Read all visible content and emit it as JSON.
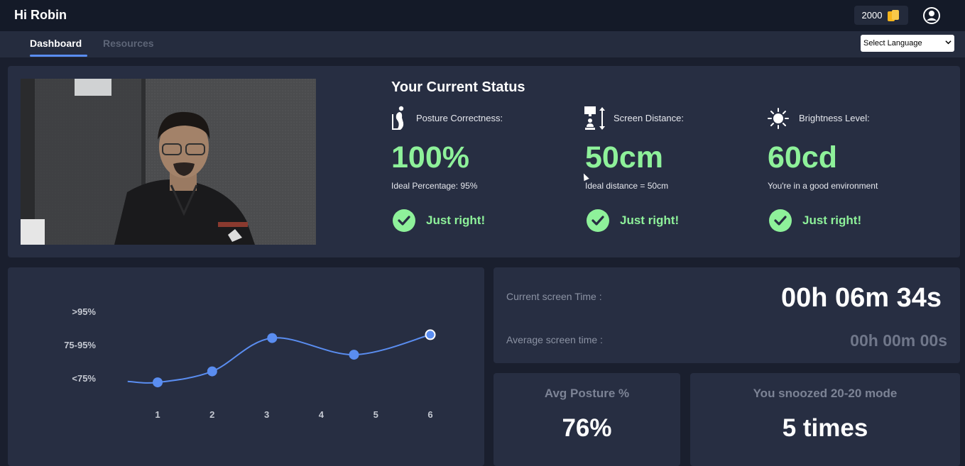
{
  "header": {
    "greeting": "Hi Robin",
    "coins": "2000"
  },
  "nav": {
    "tabs": [
      {
        "label": "Dashboard",
        "active": true
      },
      {
        "label": "Resources",
        "active": false
      }
    ],
    "language_select": "Select Language"
  },
  "status": {
    "title": "Your Current Status",
    "posture": {
      "label": "Posture Correctness:",
      "value": "100%",
      "sub": "Ideal Percentage: 95%",
      "result": "Just right!",
      "icon": "posture-icon"
    },
    "distance": {
      "label": "Screen Distance:",
      "value": "50cm",
      "sub": "Ideal distance = 50cm",
      "result": "Just right!",
      "icon": "screen-distance-icon"
    },
    "brightness": {
      "label": "Brightness Level:",
      "value": "60cd",
      "sub": "You're in a good environment",
      "result": "Just right!",
      "icon": "sun-icon"
    }
  },
  "screen_time": {
    "current_label": "Current screen Time :",
    "current_value": "00h 06m 34s",
    "average_label": "Average screen time :",
    "average_value": "00h 00m 00s"
  },
  "cards": {
    "avg_posture_title": "Avg Posture %",
    "avg_posture_value": "76%",
    "snooze_title": "You snoozed 20-20 mode",
    "snooze_value": "5 times"
  },
  "colors": {
    "accent_green": "#8ef19a",
    "accent_blue": "#5a8df0"
  },
  "chart_data": {
    "type": "line",
    "categories": [
      "1",
      "2",
      "3",
      "4",
      "5",
      "6"
    ],
    "y_bands": [
      "<75%",
      "75-95%",
      ">95%"
    ],
    "points": [
      {
        "x": 1,
        "y": 0.87
      },
      {
        "x": 2,
        "y": 1.2
      },
      {
        "x": 3.1,
        "y": 2.2
      },
      {
        "x": 4.6,
        "y": 1.7
      },
      {
        "x": 6,
        "y": 2.3
      }
    ],
    "curve_start": {
      "x": 0.45,
      "y": 0.9
    },
    "grid": false
  }
}
